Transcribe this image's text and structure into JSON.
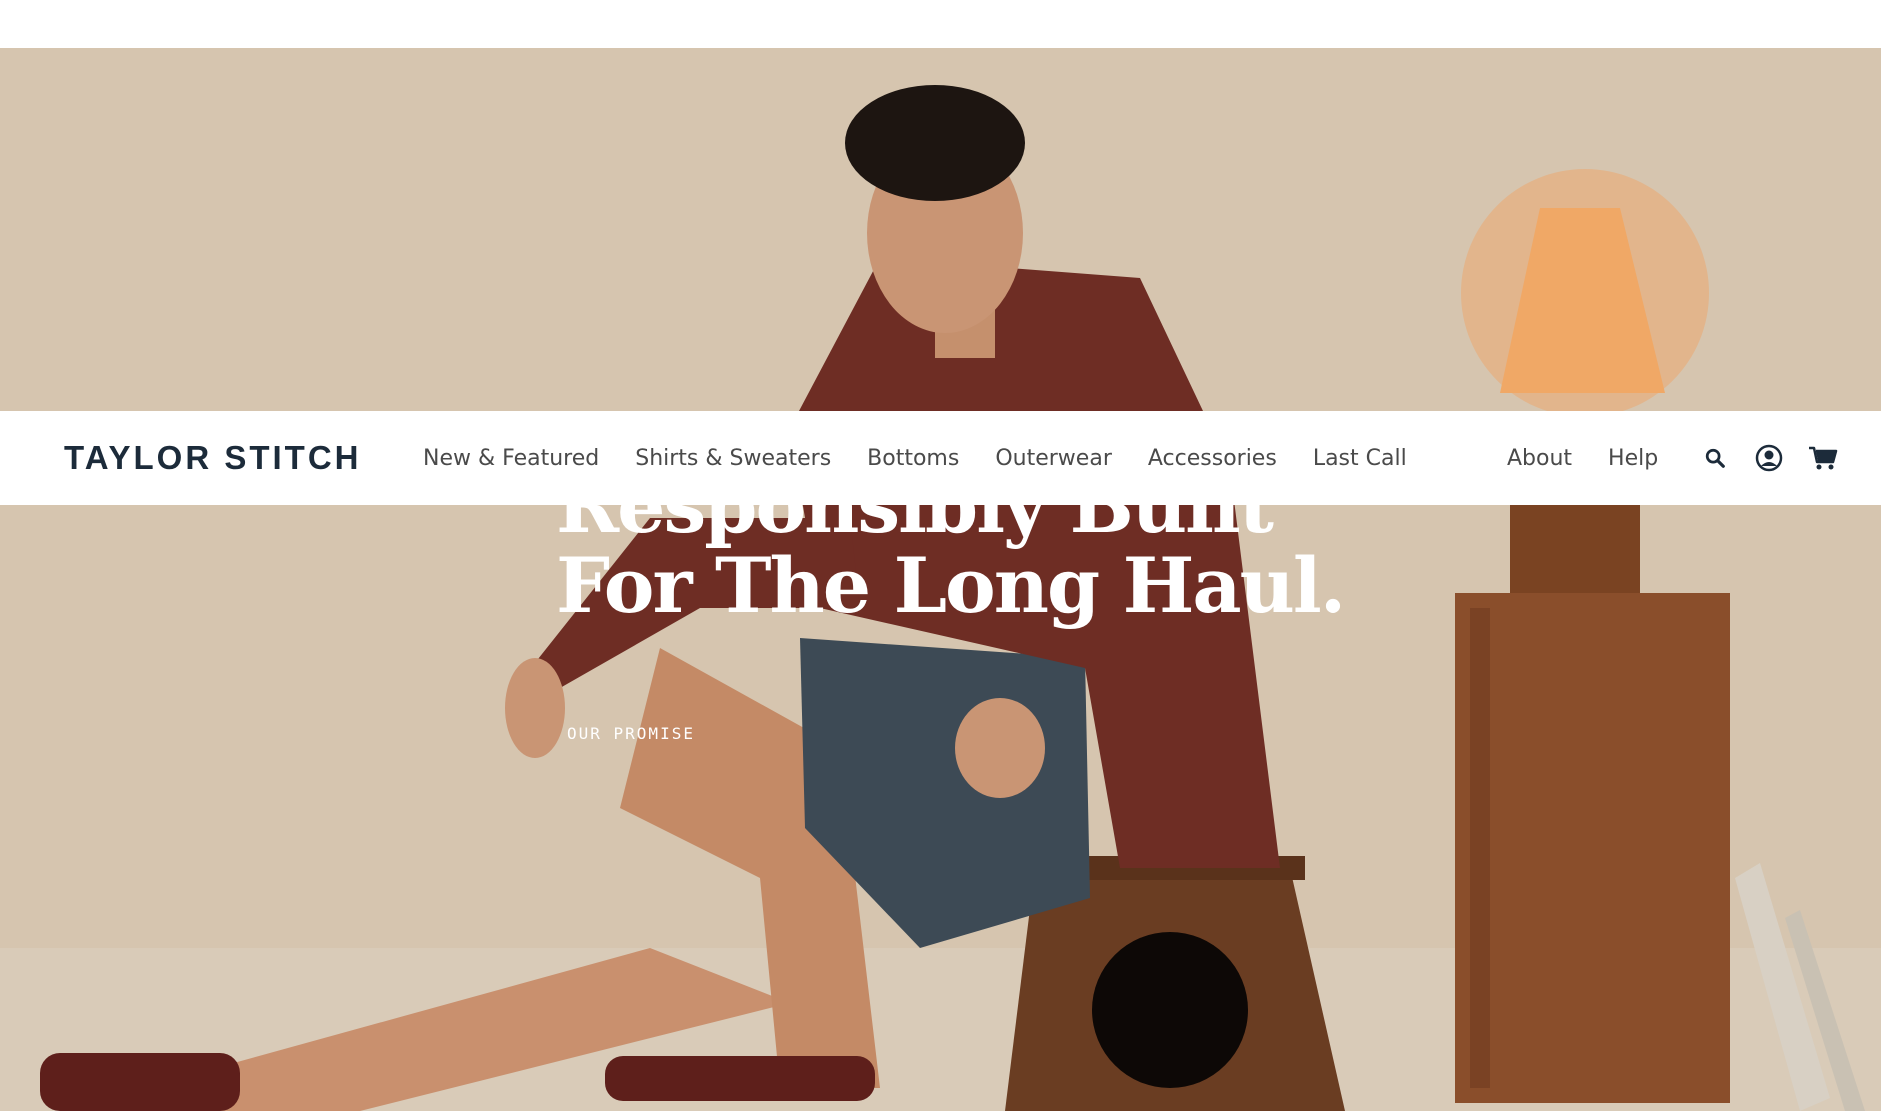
{
  "brand": {
    "logo_text": "TAYLOR STITCH",
    "color": "#1c2b3a"
  },
  "nav": {
    "main": [
      {
        "label": "New & Featured"
      },
      {
        "label": "Shirts & Sweaters"
      },
      {
        "label": "Bottoms"
      },
      {
        "label": "Outerwear"
      },
      {
        "label": "Accessories"
      },
      {
        "label": "Last Call"
      }
    ],
    "secondary": [
      {
        "label": "About"
      },
      {
        "label": "Help"
      }
    ],
    "icons": [
      "search-icon",
      "account-icon",
      "cart-icon"
    ]
  },
  "hero": {
    "headline_line1": "Responsibly Built",
    "headline_line2": "For The Long Haul.",
    "cta_label": "OUR PROMISE"
  },
  "colors": {
    "nav_text": "#4a4a4a",
    "hero_background": "#d6c5af",
    "headline": "#ffffff"
  }
}
